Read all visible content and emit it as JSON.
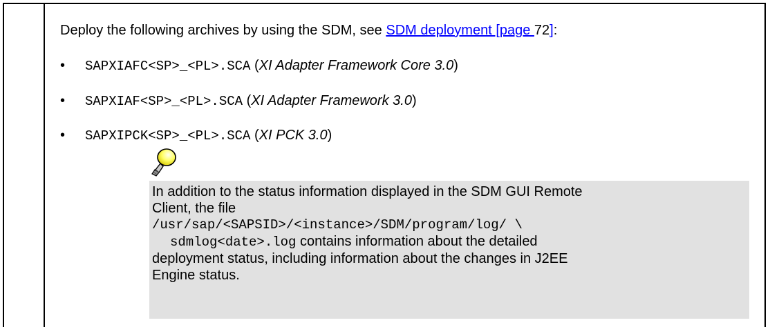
{
  "intro": {
    "text_before": "Deploy the following archives by using the SDM, see ",
    "link_text": "SDM deployment [page ",
    "page_number": "72",
    "link_close": "]",
    "text_after": ":"
  },
  "archives": [
    {
      "file": "SAPXIAFC<SP>_<PL>.SCA",
      "open": " (",
      "name": "XI Adapter Framework Core 3.0",
      "close": ")"
    },
    {
      "file": "SAPXIAF<SP>_<PL>.SCA",
      "open": " (",
      "name": "XI Adapter Framework 3.0",
      "close": ")"
    },
    {
      "file": "SAPXIPCK<SP>_<PL>.SCA",
      "open": " (",
      "name": "XI PCK 3.0",
      "close": ")"
    }
  ],
  "bullet_glyph": "•",
  "note": {
    "icon": "lightbulb-icon",
    "line1": "In addition to the status information displayed in the SDM GUI Remote",
    "line2": "Client, the file",
    "path": "/usr/sap/<SAPSID>/<instance>/SDM/program/log/   \\",
    "logfile": "sdmlog<date>.log",
    "line4_rest": " contains information about the detailed",
    "line5": "deployment status, including information about the changes in J2EE",
    "line6": "Engine status."
  },
  "colors": {
    "link": "#0000ff",
    "note_background": "#e1e1e1",
    "border": "#000000"
  }
}
